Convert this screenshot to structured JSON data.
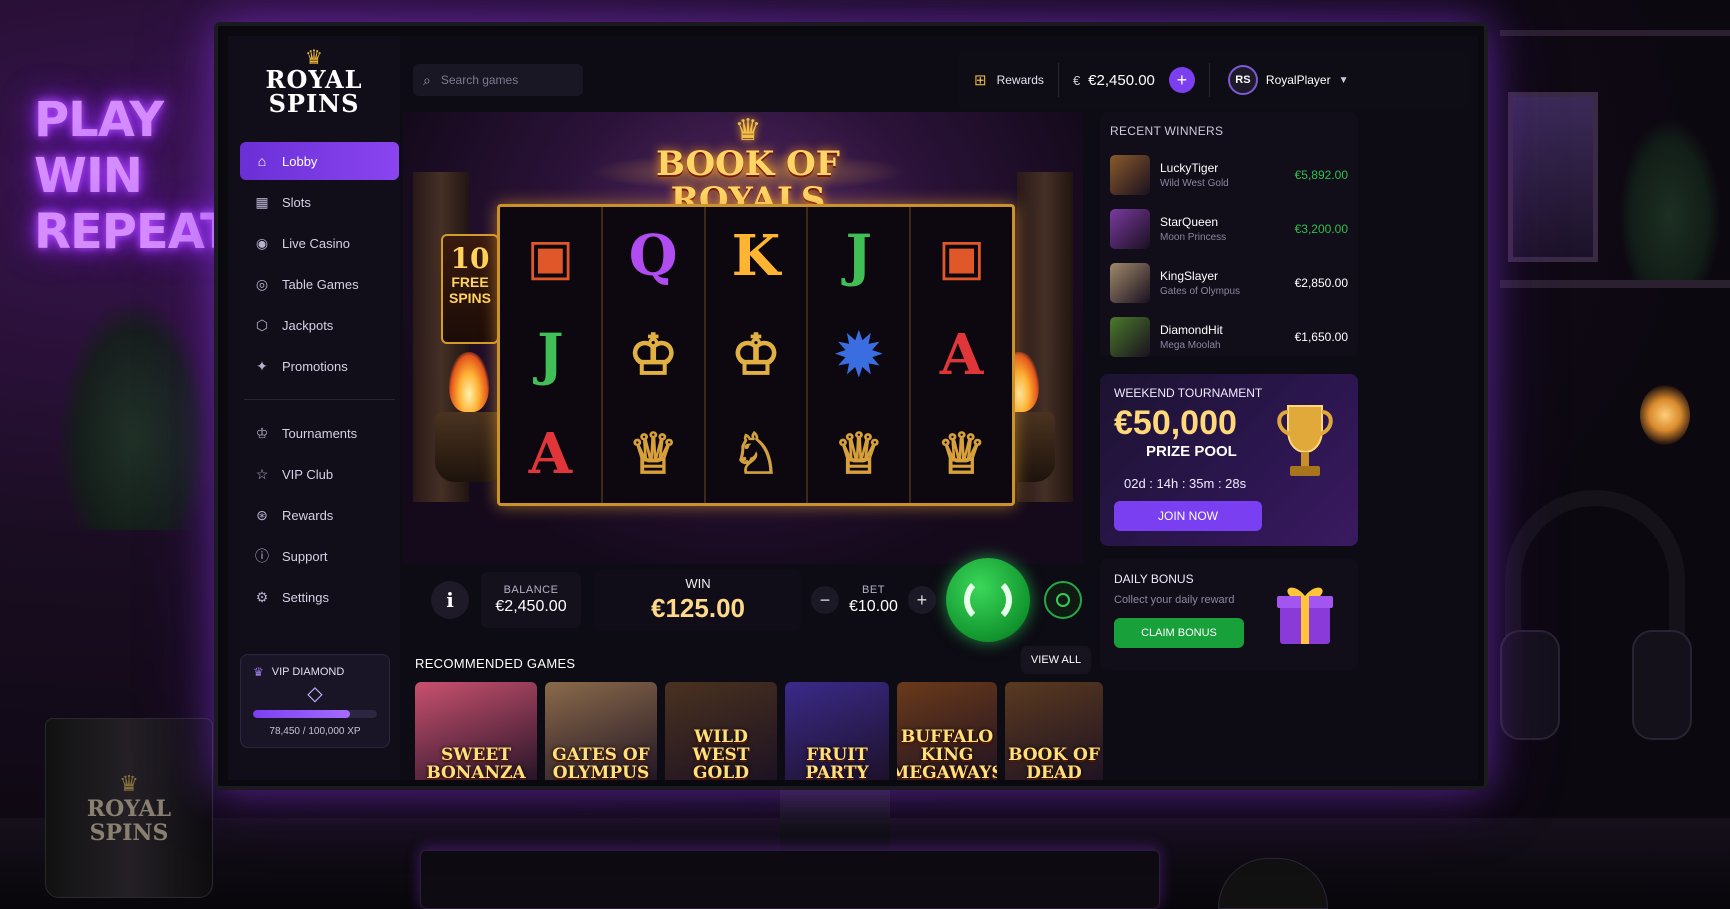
{
  "room": {
    "neon_sign": [
      "PLAY",
      "WIN",
      "REPEAT"
    ],
    "mug_brand": [
      "ROYAL",
      "SPINS"
    ]
  },
  "app": {
    "logo": [
      "ROYAL",
      "SPINS"
    ]
  },
  "sidebar": {
    "items": [
      {
        "label": "Lobby",
        "icon": "home-icon",
        "active": true
      },
      {
        "label": "Slots",
        "icon": "slots-icon"
      },
      {
        "label": "Live Casino",
        "icon": "live-casino-icon"
      },
      {
        "label": "Table Games",
        "icon": "table-games-icon"
      },
      {
        "label": "Jackpots",
        "icon": "jackpot-icon"
      },
      {
        "label": "Promotions",
        "icon": "promotions-icon"
      },
      {
        "label": "Tournaments",
        "icon": "trophy-icon"
      },
      {
        "label": "VIP Club",
        "icon": "vip-icon"
      },
      {
        "label": "Rewards",
        "icon": "rewards-icon"
      },
      {
        "label": "Support",
        "icon": "support-icon"
      },
      {
        "label": "Settings",
        "icon": "settings-icon"
      }
    ],
    "vip": {
      "title": "VIP DIAMOND",
      "xp_text": "78,450 / 100,000 XP",
      "progress": 0.7845
    }
  },
  "topbar": {
    "search_placeholder": "Search games",
    "rewards_label": "Rewards",
    "balance": "€2,450.00",
    "avatar_initials": "RS",
    "username": "RoyalPlayer"
  },
  "game": {
    "title": [
      "BOOK OF",
      "ROYALS"
    ],
    "free_spins": {
      "count": "10",
      "label": [
        "FREE",
        "SPINS"
      ]
    },
    "reels": [
      [
        "book",
        "J",
        "A"
      ],
      [
        "Q",
        "pharaoh",
        "queen"
      ],
      [
        "K",
        "pharaoh",
        "anubis"
      ],
      [
        "J",
        "scarab",
        "queen"
      ],
      [
        "book",
        "A",
        "queen"
      ]
    ],
    "balance_label": "BALANCE",
    "balance_value": "€2,450.00",
    "win_label": "WIN",
    "win_value": "€125.00",
    "bet_label": "BET",
    "bet_value": "€10.00",
    "bet_minus": "−",
    "bet_plus": "+",
    "info": "i"
  },
  "recommended": {
    "title": "RECOMMENDED GAMES",
    "view_all": "VIEW ALL",
    "games": [
      {
        "name": "SWEET BONANZA",
        "bg": "#c9516f"
      },
      {
        "name": "GATES OF OLYMPUS",
        "bg": "#8a6a4a"
      },
      {
        "name": "WILD WEST GOLD",
        "bg": "#4a3220"
      },
      {
        "name": "FRUIT PARTY",
        "bg": "#3b2a8a"
      },
      {
        "name": "BUFFALO KING MEGAWAYS",
        "bg": "#6a3a1a"
      },
      {
        "name": "BOOK OF DEAD",
        "bg": "#5a3a20"
      }
    ]
  },
  "winners": {
    "title": "RECENT WINNERS",
    "rows": [
      {
        "name": "LuckyTiger",
        "game": "Wild West Gold",
        "amount": "€5,892.00",
        "color": "#2fbf4f",
        "thumb": "#8a5a2a"
      },
      {
        "name": "StarQueen",
        "game": "Moon Princess",
        "amount": "€3,200.00",
        "color": "#2fbf4f",
        "thumb": "#7a3aa0"
      },
      {
        "name": "KingSlayer",
        "game": "Gates of Olympus",
        "amount": "€2,850.00",
        "color": "#ffffff",
        "thumb": "#a08a6a"
      },
      {
        "name": "DiamondHit",
        "game": "Mega Moolah",
        "amount": "€1,650.00",
        "color": "#ffffff",
        "thumb": "#4a7a2a"
      }
    ]
  },
  "tournament": {
    "title": "WEEKEND TOURNAMENT",
    "amount": "€50,000",
    "subtitle": "PRIZE POOL",
    "timer": "02d : 14h : 35m : 28s",
    "join_label": "JOIN NOW"
  },
  "daily_bonus": {
    "title": "DAILY BONUS",
    "subtitle": "Collect your daily reward",
    "claim_label": "CLAIM BONUS"
  },
  "colors": {
    "accent": "#7c3ff0",
    "win_green": "#2fbf4f",
    "gold": "#ffd35c"
  }
}
